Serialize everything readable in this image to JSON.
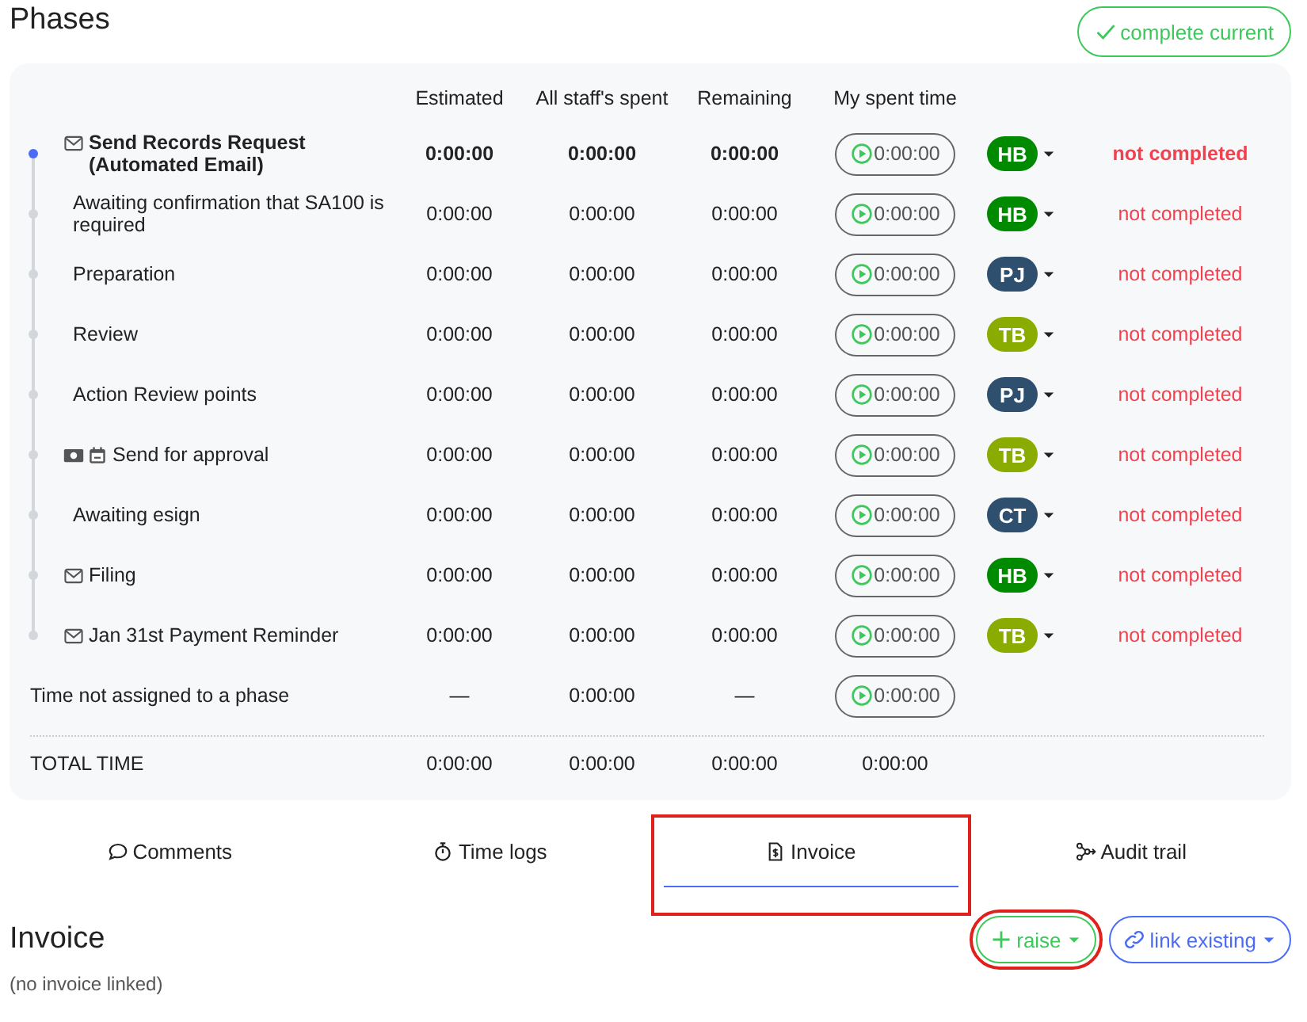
{
  "title": "Phases",
  "complete_button": {
    "label": "complete current"
  },
  "columns": [
    "Estimated",
    "All staff's spent",
    "Remaining",
    "My spent time"
  ],
  "phases": [
    {
      "name": "Send Records Request (Automated Email)",
      "kind": "email",
      "current": true,
      "estimated": "0:00:00",
      "all_staff_spent": "0:00:00",
      "remaining": "0:00:00",
      "my_spent": "0:00:00",
      "assignee": {
        "initials": "HB",
        "color": "#008a00"
      },
      "status": "not completed"
    },
    {
      "name": "Awaiting confirmation that SA100 is required",
      "kind": "task",
      "current": false,
      "estimated": "0:00:00",
      "all_staff_spent": "0:00:00",
      "remaining": "0:00:00",
      "my_spent": "0:00:00",
      "assignee": {
        "initials": "HB",
        "color": "#008a00"
      },
      "status": "not completed"
    },
    {
      "name": "Preparation",
      "kind": "task",
      "current": false,
      "estimated": "0:00:00",
      "all_staff_spent": "0:00:00",
      "remaining": "0:00:00",
      "my_spent": "0:00:00",
      "assignee": {
        "initials": "PJ",
        "color": "#2f4f6f"
      },
      "status": "not completed"
    },
    {
      "name": "Review",
      "kind": "task",
      "current": false,
      "estimated": "0:00:00",
      "all_staff_spent": "0:00:00",
      "remaining": "0:00:00",
      "my_spent": "0:00:00",
      "assignee": {
        "initials": "TB",
        "color": "#8aab00"
      },
      "status": "not completed"
    },
    {
      "name": "Action Review points",
      "kind": "task",
      "current": false,
      "estimated": "0:00:00",
      "all_staff_spent": "0:00:00",
      "remaining": "0:00:00",
      "my_spent": "0:00:00",
      "assignee": {
        "initials": "PJ",
        "color": "#2f4f6f"
      },
      "status": "not completed"
    },
    {
      "name": "Send for approval",
      "kind": "approval",
      "current": false,
      "estimated": "0:00:00",
      "all_staff_spent": "0:00:00",
      "remaining": "0:00:00",
      "my_spent": "0:00:00",
      "assignee": {
        "initials": "TB",
        "color": "#8aab00"
      },
      "status": "not completed"
    },
    {
      "name": "Awaiting esign",
      "kind": "task",
      "current": false,
      "estimated": "0:00:00",
      "all_staff_spent": "0:00:00",
      "remaining": "0:00:00",
      "my_spent": "0:00:00",
      "assignee": {
        "initials": "CT",
        "color": "#2f4f6f"
      },
      "status": "not completed"
    },
    {
      "name": "Filing",
      "kind": "email",
      "current": false,
      "estimated": "0:00:00",
      "all_staff_spent": "0:00:00",
      "remaining": "0:00:00",
      "my_spent": "0:00:00",
      "assignee": {
        "initials": "HB",
        "color": "#008a00"
      },
      "status": "not completed"
    },
    {
      "name": "Jan 31st Payment Reminder",
      "kind": "email",
      "current": false,
      "estimated": "0:00:00",
      "all_staff_spent": "0:00:00",
      "remaining": "0:00:00",
      "my_spent": "0:00:00",
      "assignee": {
        "initials": "TB",
        "color": "#8aab00"
      },
      "status": "not completed"
    }
  ],
  "unassigned": {
    "label": "Time not assigned to a phase",
    "estimated": "—",
    "all_staff_spent": "0:00:00",
    "remaining": "—",
    "my_spent": "0:00:00"
  },
  "total": {
    "label": "TOTAL TIME",
    "estimated": "0:00:00",
    "all_staff_spent": "0:00:00",
    "remaining": "0:00:00",
    "my_spent": "0:00:00"
  },
  "tabs": [
    {
      "label": "Comments",
      "selected": false,
      "highlighted": false
    },
    {
      "label": "Time logs",
      "selected": false,
      "highlighted": false
    },
    {
      "label": "Invoice",
      "selected": true,
      "highlighted": true
    },
    {
      "label": "Audit trail",
      "selected": false,
      "highlighted": false
    }
  ],
  "invoice": {
    "title": "Invoice",
    "empty_text": "(no invoice linked)",
    "buttons": [
      {
        "label": "raise",
        "kind": "raise",
        "highlighted": true
      },
      {
        "label": "link existing",
        "kind": "link",
        "highlighted": false
      }
    ]
  }
}
